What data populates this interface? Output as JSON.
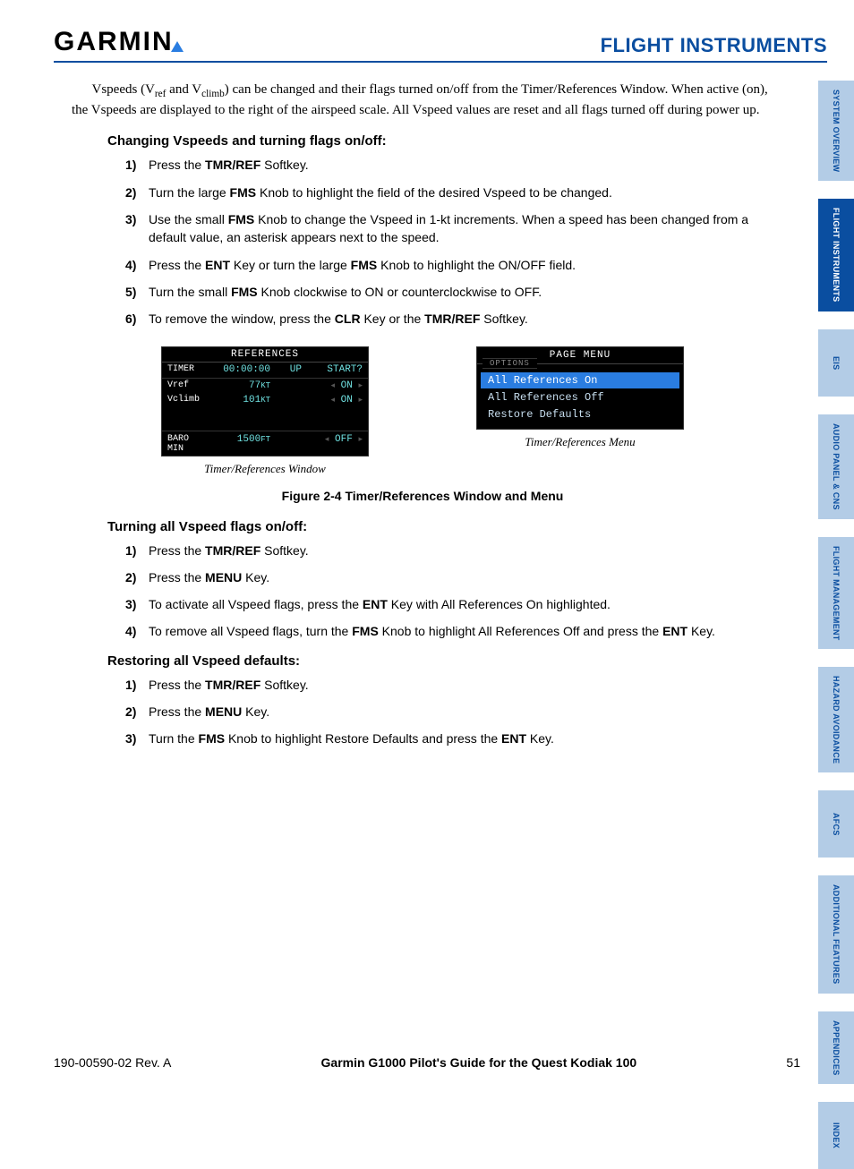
{
  "header": {
    "brand_text": "GARMIN",
    "chapter": "FLIGHT INSTRUMENTS"
  },
  "tabs": [
    {
      "label": "SYSTEM OVERVIEW",
      "active": false
    },
    {
      "label": "FLIGHT INSTRUMENTS",
      "active": true
    },
    {
      "label": "EIS",
      "active": false
    },
    {
      "label": "AUDIO PANEL & CNS",
      "active": false
    },
    {
      "label": "FLIGHT MANAGEMENT",
      "active": false
    },
    {
      "label": "HAZARD AVOIDANCE",
      "active": false
    },
    {
      "label": "AFCS",
      "active": false
    },
    {
      "label": "ADDITIONAL FEATURES",
      "active": false
    },
    {
      "label": "APPENDICES",
      "active": false
    },
    {
      "label": "INDEX",
      "active": false
    }
  ],
  "intro": {
    "pre": "Vspeeds (V",
    "sub1": "ref",
    "mid": " and V",
    "sub2": "climb",
    "post": ") can be changed and their flags turned on/off from the Timer/References Window.  When active (on), the Vspeeds are displayed to the right of the airspeed scale.  All Vspeed values are reset and all flags turned off during power up."
  },
  "section1": {
    "title": "Changing Vspeeds and turning flags on/off:",
    "steps": [
      {
        "pre": "Press the ",
        "b1": "TMR/REF",
        "post": " Softkey."
      },
      {
        "pre": "Turn the large ",
        "b1": "FMS",
        "post": " Knob to highlight the field of the desired Vspeed to be changed."
      },
      {
        "pre": "Use the small ",
        "b1": "FMS",
        "post": " Knob to change the Vspeed in 1-kt increments.  When a speed has been changed from a default value, an asterisk appears next to the speed."
      },
      {
        "pre": "Press the ",
        "b1": "ENT",
        "mid": " Key or turn the large ",
        "b2": "FMS",
        "post": " Knob to highlight the ON/OFF field."
      },
      {
        "pre": "Turn the small ",
        "b1": "FMS",
        "post": " Knob clockwise to ON or counterclockwise to OFF."
      },
      {
        "pre": "To remove the window, press the ",
        "b1": "CLR",
        "mid": " Key or the ",
        "b2": "TMR/REF",
        "post": " Softkey."
      }
    ]
  },
  "refs_window": {
    "title": "REFERENCES",
    "timer_label": "TIMER",
    "timer_value": "00:00:00",
    "timer_dir": "UP",
    "timer_action": "START?",
    "rows": [
      {
        "name": "Vref",
        "value": "77",
        "unit": "KT",
        "state": "ON"
      },
      {
        "name": "Vclimb",
        "value": "101",
        "unit": "KT",
        "state": "ON"
      }
    ],
    "baro_label": "BARO MIN",
    "baro_value": "1500",
    "baro_unit": "FT",
    "baro_state": "OFF",
    "caption": "Timer/References Window"
  },
  "menu_window": {
    "title": "PAGE MENU",
    "options_label": "OPTIONS",
    "items": [
      {
        "label": "All References On",
        "selected": true
      },
      {
        "label": "All References Off",
        "selected": false
      },
      {
        "label": "Restore Defaults",
        "selected": false
      }
    ],
    "caption": "Timer/References Menu"
  },
  "figure_title": "Figure 2-4  Timer/References Window and Menu",
  "section2": {
    "title": "Turning all Vspeed flags on/off:",
    "steps": [
      {
        "pre": "Press the ",
        "b1": "TMR/REF",
        "post": " Softkey."
      },
      {
        "pre": "Press the ",
        "b1": "MENU",
        "post": " Key."
      },
      {
        "pre": "To activate all Vspeed flags, press the ",
        "b1": "ENT",
        "post": " Key with All References On highlighted."
      },
      {
        "pre": "To remove all Vspeed flags, turn the ",
        "b1": "FMS",
        "mid": " Knob to highlight All References Off and press the ",
        "b2": "ENT",
        "post": " Key."
      }
    ]
  },
  "section3": {
    "title": "Restoring all Vspeed defaults:",
    "steps": [
      {
        "pre": "Press the ",
        "b1": "TMR/REF",
        "post": " Softkey."
      },
      {
        "pre": "Press the ",
        "b1": "MENU",
        "post": " Key."
      },
      {
        "pre": "Turn the ",
        "b1": "FMS",
        "mid": " Knob to highlight Restore Defaults and press the ",
        "b2": "ENT",
        "post": " Key."
      }
    ]
  },
  "footer": {
    "left": "190-00590-02  Rev. A",
    "center": "Garmin G1000 Pilot's Guide for the Quest Kodiak 100",
    "right": "51"
  }
}
